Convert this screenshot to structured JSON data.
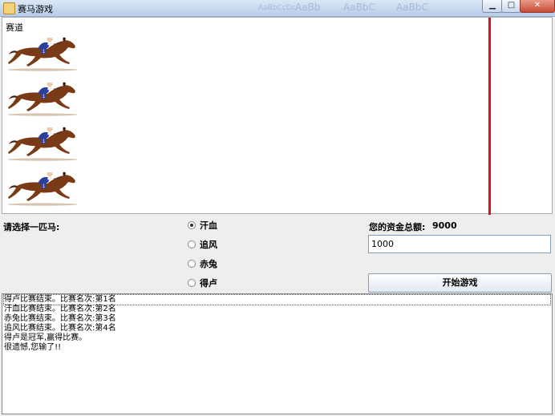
{
  "window": {
    "title": "赛马游戏",
    "background_tabs": [
      "AaBbCcDc",
      "AaBb",
      "AaBbC",
      "AaBbC"
    ],
    "controls": [
      "minimize",
      "maximize",
      "close"
    ]
  },
  "track": {
    "label": "赛道",
    "horse_count": 4,
    "finish_line_color": "#e01010",
    "horse_icon": "racehorse-with-jockey-icon"
  },
  "controls": {
    "choose_label": "请选择一匹马:",
    "horses": [
      {
        "name": "汗血",
        "selected": true
      },
      {
        "name": "追风",
        "selected": false
      },
      {
        "name": "赤兔",
        "selected": false
      },
      {
        "name": "得卢",
        "selected": false
      }
    ],
    "funds_label": "您的资金总额:",
    "funds_value": "9000",
    "bet_input_value": "1000",
    "start_button": "开始游戏"
  },
  "log": {
    "lines": [
      "得卢比赛结束。比赛名次:第1名",
      "汗血比赛结束。比赛名次:第2名",
      "赤兔比赛结束。比赛名次:第3名",
      "追风比赛结束。比赛名次:第4名",
      "得卢是冠军,赢得比赛。",
      "很遗憾,您输了!!"
    ]
  }
}
